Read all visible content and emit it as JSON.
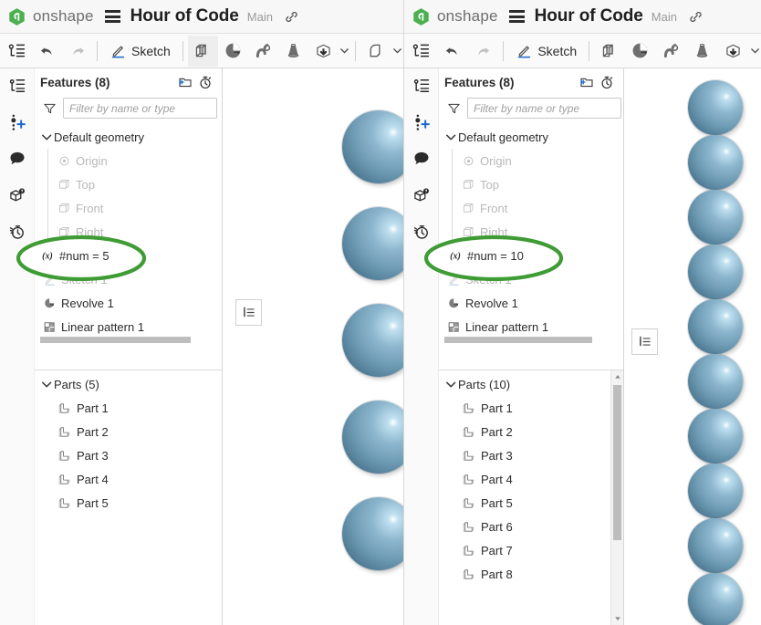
{
  "colors": {
    "brand_green": "#43a047",
    "annotation_green": "#3f9c35",
    "sphere_blue": "#78a6bf",
    "sphere_blue_dark": "#46708a",
    "accent_blue": "#1b6ac9",
    "header_bg": "#f7f7f7",
    "toolbar_bg": "#fafafa"
  },
  "header": {
    "logo_text": "onshape",
    "logo_icon": "onshape-logo-icon",
    "menu_icon": "hamburger-menu-icon",
    "doc_title": "Hour of Code",
    "branch": "Main",
    "link_icon": "link-icon"
  },
  "toolbar": {
    "feature_list_icon": "feature-list-icon",
    "undo_icon": "undo-icon",
    "redo_icon": "redo-icon",
    "sketch_label": "Sketch",
    "sketch_icon": "pencil-sketch-icon",
    "extrude_icon": "extrude-icon",
    "revolve_icon": "revolve-icon",
    "sweep_icon": "sweep-icon",
    "loft_icon": "loft-icon",
    "import_icon": "import-derived-icon",
    "dropdown_icon": "chevron-down-icon",
    "fillet_icon": "fillet-icon"
  },
  "rail": {
    "items": [
      {
        "icon": "feature-tree-icon",
        "name": "rail-feature-tree"
      },
      {
        "icon": "add-mate-connector-icon",
        "name": "rail-add-point"
      },
      {
        "icon": "comment-bubble-icon",
        "name": "rail-comments"
      },
      {
        "icon": "cube-question-icon",
        "name": "rail-part-info"
      },
      {
        "icon": "stopwatch-history-icon",
        "name": "rail-history"
      }
    ]
  },
  "left_panel": {
    "features_title": "Features (8)",
    "add_folder_icon": "add-folder-icon",
    "rollback_icon": "rollback-timer-icon",
    "filter_icon": "filter-funnel-icon",
    "filter_placeholder": "Filter by name or type",
    "filter_value": "",
    "tree": [
      {
        "label": "Default geometry",
        "icon": "chevron-down-icon",
        "kind": "group",
        "dim": false
      },
      {
        "label": "Origin",
        "icon": "origin-icon",
        "kind": "child",
        "dim": true
      },
      {
        "label": "Top",
        "icon": "plane-icon",
        "kind": "child",
        "dim": true
      },
      {
        "label": "Front",
        "icon": "plane-icon",
        "kind": "child",
        "dim": true
      },
      {
        "label": "Right",
        "icon": "plane-icon",
        "kind": "child",
        "dim": true
      },
      {
        "label": "#num = 5",
        "icon": "variable-icon",
        "kind": "feature",
        "dim": false
      },
      {
        "label": "Sketch 1",
        "icon": "sketch-icon",
        "kind": "feature",
        "dim": true
      },
      {
        "label": "Revolve 1",
        "icon": "revolve-feature-icon",
        "kind": "feature",
        "dim": false
      },
      {
        "label": "Linear pattern 1",
        "icon": "linear-pattern-icon",
        "kind": "feature",
        "dim": false
      }
    ],
    "parts_title": "Parts (5)",
    "parts": [
      {
        "label": "Part 1",
        "icon": "part-icon"
      },
      {
        "label": "Part 2",
        "icon": "part-icon"
      },
      {
        "label": "Part 3",
        "icon": "part-icon"
      },
      {
        "label": "Part 4",
        "icon": "part-icon"
      },
      {
        "label": "Part 5",
        "icon": "part-icon"
      }
    ],
    "annotation": {
      "shape": "ellipse",
      "color": "#3f9c35",
      "target_label": "#num = 5"
    },
    "viewport": {
      "sphere_count": 5,
      "flyout_icon": "view-list-icon"
    }
  },
  "right_panel": {
    "features_title": "Features (8)",
    "add_folder_icon": "add-folder-icon",
    "rollback_icon": "rollback-timer-icon",
    "filter_icon": "filter-funnel-icon",
    "filter_placeholder": "Filter by name or type",
    "filter_value": "",
    "tree": [
      {
        "label": "Default geometry",
        "icon": "chevron-down-icon",
        "kind": "group",
        "dim": false
      },
      {
        "label": "Origin",
        "icon": "origin-icon",
        "kind": "child",
        "dim": true
      },
      {
        "label": "Top",
        "icon": "plane-icon",
        "kind": "child",
        "dim": true
      },
      {
        "label": "Front",
        "icon": "plane-icon",
        "kind": "child",
        "dim": true
      },
      {
        "label": "Right",
        "icon": "plane-icon",
        "kind": "child",
        "dim": true
      },
      {
        "label": "#num = 10",
        "icon": "variable-icon",
        "kind": "feature",
        "dim": false
      },
      {
        "label": "Sketch 1",
        "icon": "sketch-icon",
        "kind": "feature",
        "dim": true
      },
      {
        "label": "Revolve 1",
        "icon": "revolve-feature-icon",
        "kind": "feature",
        "dim": false
      },
      {
        "label": "Linear pattern 1",
        "icon": "linear-pattern-icon",
        "kind": "feature",
        "dim": false
      }
    ],
    "parts_title": "Parts (10)",
    "parts": [
      {
        "label": "Part 1",
        "icon": "part-icon"
      },
      {
        "label": "Part 2",
        "icon": "part-icon"
      },
      {
        "label": "Part 3",
        "icon": "part-icon"
      },
      {
        "label": "Part 4",
        "icon": "part-icon"
      },
      {
        "label": "Part 5",
        "icon": "part-icon"
      },
      {
        "label": "Part 6",
        "icon": "part-icon"
      },
      {
        "label": "Part 7",
        "icon": "part-icon"
      },
      {
        "label": "Part 8",
        "icon": "part-icon"
      }
    ],
    "annotation": {
      "shape": "ellipse",
      "color": "#3f9c35",
      "target_label": "#num = 10"
    },
    "viewport": {
      "sphere_count": 10,
      "flyout_icon": "view-list-icon"
    }
  }
}
